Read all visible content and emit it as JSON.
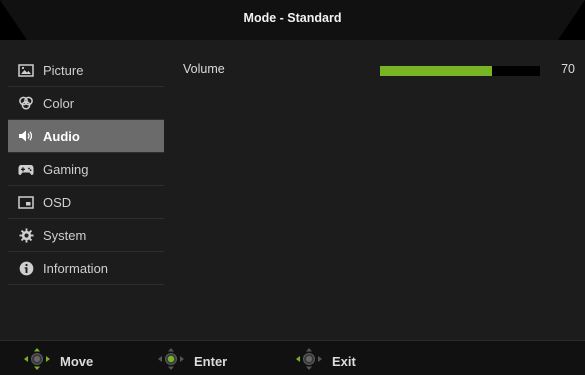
{
  "header": {
    "title": "Mode - Standard"
  },
  "sidebar": {
    "items": [
      {
        "label": "Picture",
        "icon": "picture-icon"
      },
      {
        "label": "Color",
        "icon": "color-icon"
      },
      {
        "label": "Audio",
        "icon": "speaker-icon",
        "active": true
      },
      {
        "label": "Gaming",
        "icon": "gamepad-icon"
      },
      {
        "label": "OSD",
        "icon": "osd-icon"
      },
      {
        "label": "System",
        "icon": "gear-icon"
      },
      {
        "label": "Information",
        "icon": "info-icon"
      }
    ]
  },
  "main": {
    "volume": {
      "label": "Volume",
      "value": "70",
      "level": 0.7
    }
  },
  "footer": {
    "move_label": "Move",
    "enter_label": "Enter",
    "exit_label": "Exit"
  },
  "colors": {
    "accent": "#78b424",
    "active_item_bg": "#6b6b6b"
  }
}
